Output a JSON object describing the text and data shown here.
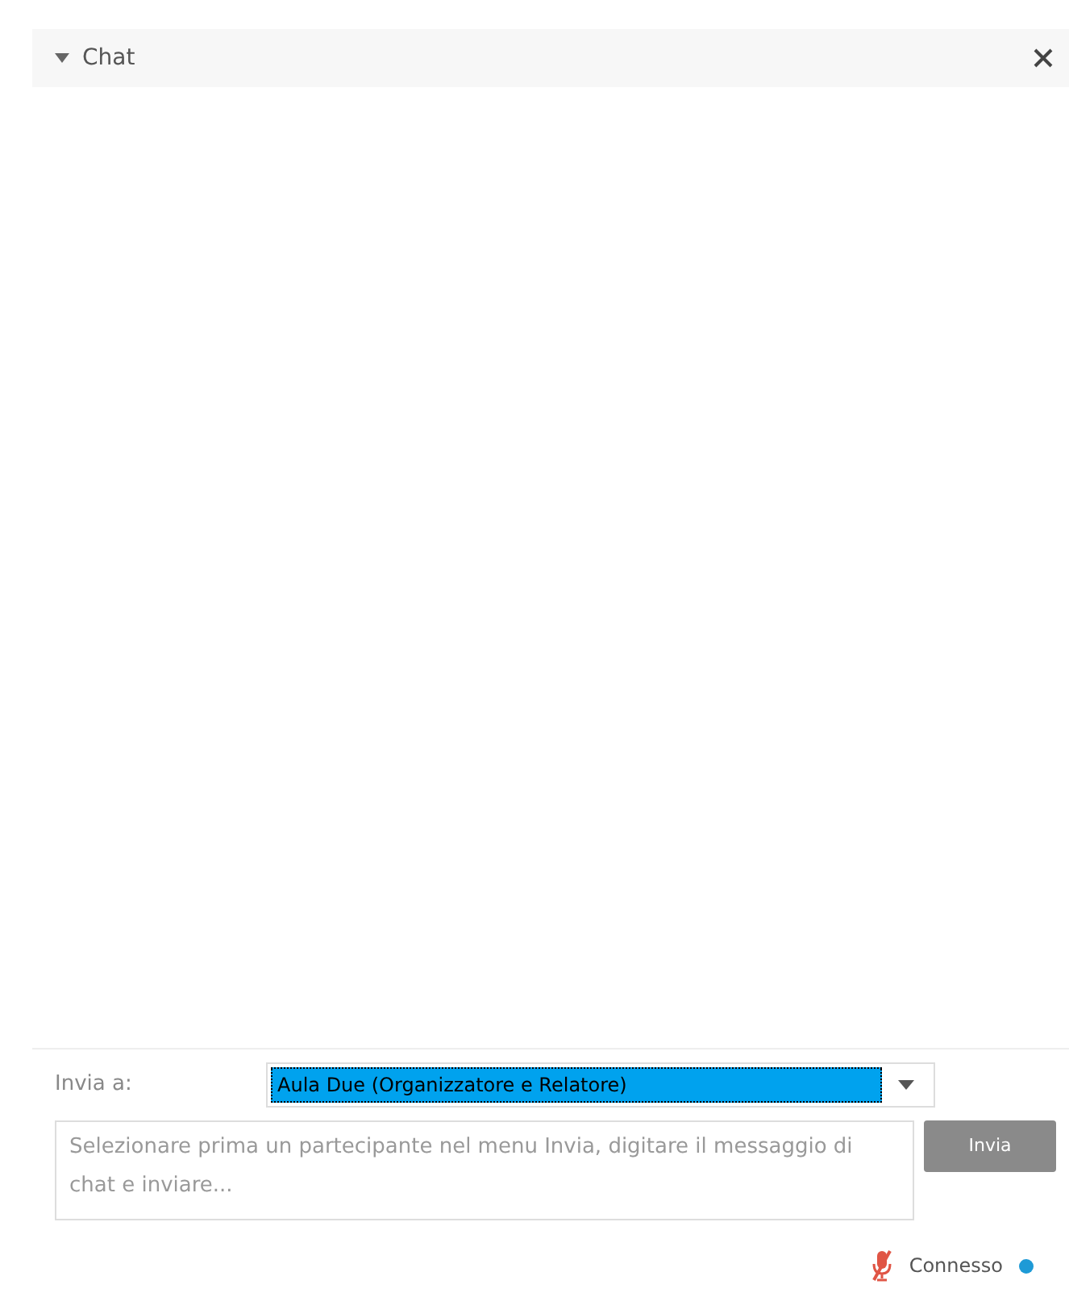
{
  "panel": {
    "title": "Chat",
    "expanded": true
  },
  "send_to": {
    "label": "Invia a:",
    "value": "Aula Due (Organizzatore e Relatore)",
    "highlighted": true
  },
  "message": {
    "placeholder": "Selezionare prima un partecipante nel menu Invia, digitare il messaggio di chat e inviare..."
  },
  "send_button": "Invia",
  "status": {
    "microphone_muted": true,
    "label": "Connesso",
    "color": "#1e9ad6"
  }
}
